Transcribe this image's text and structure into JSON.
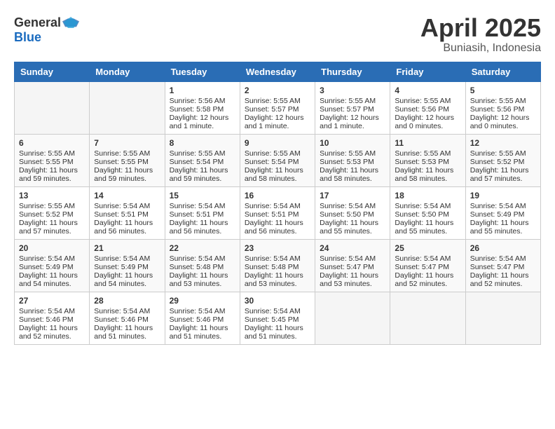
{
  "header": {
    "logo_general": "General",
    "logo_blue": "Blue",
    "month_title": "April 2025",
    "location": "Buniasih, Indonesia"
  },
  "columns": [
    "Sunday",
    "Monday",
    "Tuesday",
    "Wednesday",
    "Thursday",
    "Friday",
    "Saturday"
  ],
  "weeks": [
    [
      {
        "day": "",
        "sunrise": "",
        "sunset": "",
        "daylight": ""
      },
      {
        "day": "",
        "sunrise": "",
        "sunset": "",
        "daylight": ""
      },
      {
        "day": "1",
        "sunrise": "Sunrise: 5:56 AM",
        "sunset": "Sunset: 5:58 PM",
        "daylight": "Daylight: 12 hours and 1 minute."
      },
      {
        "day": "2",
        "sunrise": "Sunrise: 5:55 AM",
        "sunset": "Sunset: 5:57 PM",
        "daylight": "Daylight: 12 hours and 1 minute."
      },
      {
        "day": "3",
        "sunrise": "Sunrise: 5:55 AM",
        "sunset": "Sunset: 5:57 PM",
        "daylight": "Daylight: 12 hours and 1 minute."
      },
      {
        "day": "4",
        "sunrise": "Sunrise: 5:55 AM",
        "sunset": "Sunset: 5:56 PM",
        "daylight": "Daylight: 12 hours and 0 minutes."
      },
      {
        "day": "5",
        "sunrise": "Sunrise: 5:55 AM",
        "sunset": "Sunset: 5:56 PM",
        "daylight": "Daylight: 12 hours and 0 minutes."
      }
    ],
    [
      {
        "day": "6",
        "sunrise": "Sunrise: 5:55 AM",
        "sunset": "Sunset: 5:55 PM",
        "daylight": "Daylight: 11 hours and 59 minutes."
      },
      {
        "day": "7",
        "sunrise": "Sunrise: 5:55 AM",
        "sunset": "Sunset: 5:55 PM",
        "daylight": "Daylight: 11 hours and 59 minutes."
      },
      {
        "day": "8",
        "sunrise": "Sunrise: 5:55 AM",
        "sunset": "Sunset: 5:54 PM",
        "daylight": "Daylight: 11 hours and 59 minutes."
      },
      {
        "day": "9",
        "sunrise": "Sunrise: 5:55 AM",
        "sunset": "Sunset: 5:54 PM",
        "daylight": "Daylight: 11 hours and 58 minutes."
      },
      {
        "day": "10",
        "sunrise": "Sunrise: 5:55 AM",
        "sunset": "Sunset: 5:53 PM",
        "daylight": "Daylight: 11 hours and 58 minutes."
      },
      {
        "day": "11",
        "sunrise": "Sunrise: 5:55 AM",
        "sunset": "Sunset: 5:53 PM",
        "daylight": "Daylight: 11 hours and 58 minutes."
      },
      {
        "day": "12",
        "sunrise": "Sunrise: 5:55 AM",
        "sunset": "Sunset: 5:52 PM",
        "daylight": "Daylight: 11 hours and 57 minutes."
      }
    ],
    [
      {
        "day": "13",
        "sunrise": "Sunrise: 5:55 AM",
        "sunset": "Sunset: 5:52 PM",
        "daylight": "Daylight: 11 hours and 57 minutes."
      },
      {
        "day": "14",
        "sunrise": "Sunrise: 5:54 AM",
        "sunset": "Sunset: 5:51 PM",
        "daylight": "Daylight: 11 hours and 56 minutes."
      },
      {
        "day": "15",
        "sunrise": "Sunrise: 5:54 AM",
        "sunset": "Sunset: 5:51 PM",
        "daylight": "Daylight: 11 hours and 56 minutes."
      },
      {
        "day": "16",
        "sunrise": "Sunrise: 5:54 AM",
        "sunset": "Sunset: 5:51 PM",
        "daylight": "Daylight: 11 hours and 56 minutes."
      },
      {
        "day": "17",
        "sunrise": "Sunrise: 5:54 AM",
        "sunset": "Sunset: 5:50 PM",
        "daylight": "Daylight: 11 hours and 55 minutes."
      },
      {
        "day": "18",
        "sunrise": "Sunrise: 5:54 AM",
        "sunset": "Sunset: 5:50 PM",
        "daylight": "Daylight: 11 hours and 55 minutes."
      },
      {
        "day": "19",
        "sunrise": "Sunrise: 5:54 AM",
        "sunset": "Sunset: 5:49 PM",
        "daylight": "Daylight: 11 hours and 55 minutes."
      }
    ],
    [
      {
        "day": "20",
        "sunrise": "Sunrise: 5:54 AM",
        "sunset": "Sunset: 5:49 PM",
        "daylight": "Daylight: 11 hours and 54 minutes."
      },
      {
        "day": "21",
        "sunrise": "Sunrise: 5:54 AM",
        "sunset": "Sunset: 5:49 PM",
        "daylight": "Daylight: 11 hours and 54 minutes."
      },
      {
        "day": "22",
        "sunrise": "Sunrise: 5:54 AM",
        "sunset": "Sunset: 5:48 PM",
        "daylight": "Daylight: 11 hours and 53 minutes."
      },
      {
        "day": "23",
        "sunrise": "Sunrise: 5:54 AM",
        "sunset": "Sunset: 5:48 PM",
        "daylight": "Daylight: 11 hours and 53 minutes."
      },
      {
        "day": "24",
        "sunrise": "Sunrise: 5:54 AM",
        "sunset": "Sunset: 5:47 PM",
        "daylight": "Daylight: 11 hours and 53 minutes."
      },
      {
        "day": "25",
        "sunrise": "Sunrise: 5:54 AM",
        "sunset": "Sunset: 5:47 PM",
        "daylight": "Daylight: 11 hours and 52 minutes."
      },
      {
        "day": "26",
        "sunrise": "Sunrise: 5:54 AM",
        "sunset": "Sunset: 5:47 PM",
        "daylight": "Daylight: 11 hours and 52 minutes."
      }
    ],
    [
      {
        "day": "27",
        "sunrise": "Sunrise: 5:54 AM",
        "sunset": "Sunset: 5:46 PM",
        "daylight": "Daylight: 11 hours and 52 minutes."
      },
      {
        "day": "28",
        "sunrise": "Sunrise: 5:54 AM",
        "sunset": "Sunset: 5:46 PM",
        "daylight": "Daylight: 11 hours and 51 minutes."
      },
      {
        "day": "29",
        "sunrise": "Sunrise: 5:54 AM",
        "sunset": "Sunset: 5:46 PM",
        "daylight": "Daylight: 11 hours and 51 minutes."
      },
      {
        "day": "30",
        "sunrise": "Sunrise: 5:54 AM",
        "sunset": "Sunset: 5:45 PM",
        "daylight": "Daylight: 11 hours and 51 minutes."
      },
      {
        "day": "",
        "sunrise": "",
        "sunset": "",
        "daylight": ""
      },
      {
        "day": "",
        "sunrise": "",
        "sunset": "",
        "daylight": ""
      },
      {
        "day": "",
        "sunrise": "",
        "sunset": "",
        "daylight": ""
      }
    ]
  ]
}
